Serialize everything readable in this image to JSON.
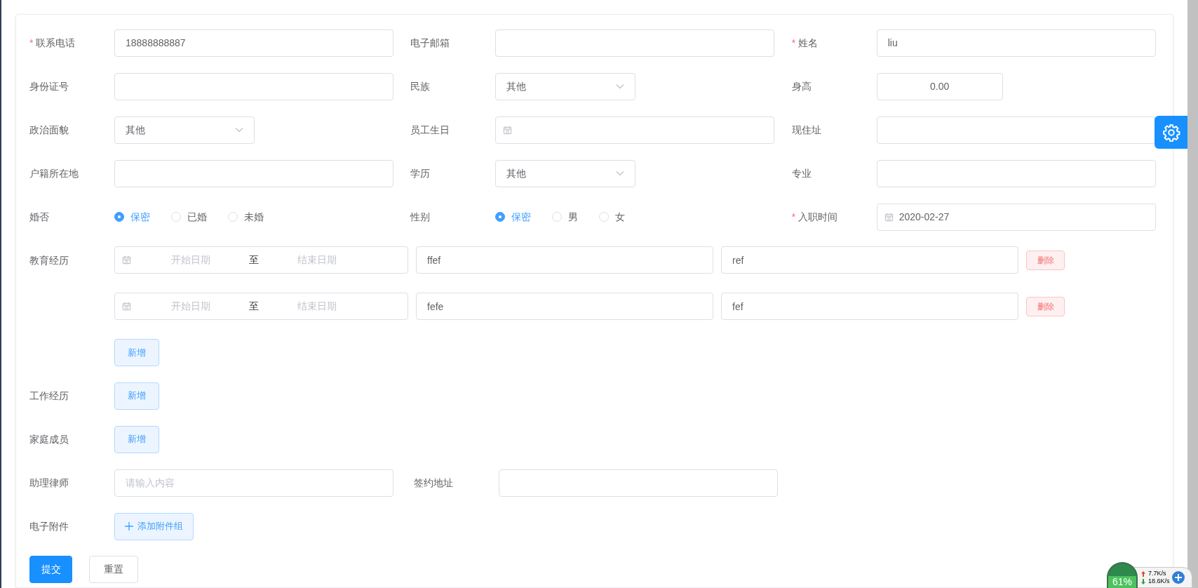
{
  "form_rows": [
    [
      {
        "label": "联系电话",
        "required_mark": "*",
        "kind": "text",
        "value": "18888888887"
      },
      {
        "label": "电子邮箱",
        "kind": "text"
      },
      {
        "label": "姓名",
        "required_mark": "*",
        "kind": "text",
        "value": "liu"
      }
    ],
    [
      {
        "label": "身份证号",
        "kind": "text"
      },
      {
        "label": "民族",
        "kind": "select",
        "value": "其他"
      },
      {
        "label": "身高",
        "kind": "number",
        "value": "0.00"
      }
    ],
    [
      {
        "label": "政治面貌",
        "kind": "select",
        "value": "其他"
      },
      {
        "label": "员工生日",
        "kind": "date"
      },
      {
        "label": "现住址",
        "kind": "text"
      }
    ],
    [
      {
        "label": "户籍所在地",
        "kind": "text"
      },
      {
        "label": "学历",
        "kind": "select",
        "value": "其他"
      },
      {
        "label": "专业",
        "kind": "text"
      }
    ],
    [
      {
        "label": "婚否",
        "kind": "radio",
        "options": [
          {
            "label": "保密",
            "selected": true
          },
          {
            "label": "已婚",
            "selected": false
          },
          {
            "label": "未婚",
            "selected": false
          }
        ]
      },
      {
        "label": "性别",
        "kind": "radio",
        "options": [
          {
            "label": "保密",
            "selected": true
          },
          {
            "label": "男",
            "selected": false
          },
          {
            "label": "女",
            "selected": false
          }
        ]
      },
      {
        "label": "入职时间",
        "required_mark": "*",
        "kind": "date",
        "value": "2020-02-27"
      }
    ]
  ],
  "education": {
    "label": "教育经历",
    "entries": [
      {
        "start_placeholder": "开始日期",
        "separator": "至",
        "end_placeholder": "结束日期",
        "school": "ffef",
        "major": "ref",
        "delete_label": "删除"
      },
      {
        "start_placeholder": "开始日期",
        "separator": "至",
        "end_placeholder": "结束日期",
        "school": "fefe",
        "major": "fef",
        "delete_label": "删除"
      }
    ],
    "add_label": "新增"
  },
  "work_experience": {
    "label": "工作经历",
    "add_label": "新增"
  },
  "family_members": {
    "label": "家庭成员",
    "add_label": "新增"
  },
  "lawyer_row": [
    {
      "label": "助理律师",
      "kind": "text",
      "placeholder": "请输入内容"
    },
    {
      "label": "签约地址",
      "kind": "text"
    }
  ],
  "attachments": {
    "label": "电子附件",
    "button": "添加附件组"
  },
  "actions": [
    {
      "label": "提交",
      "kind": "primary"
    },
    {
      "label": "重置",
      "kind": "default"
    }
  ],
  "tray_widget": {
    "percent": "61%",
    "upload": "7.7K/s",
    "download": "18.6K/s"
  }
}
